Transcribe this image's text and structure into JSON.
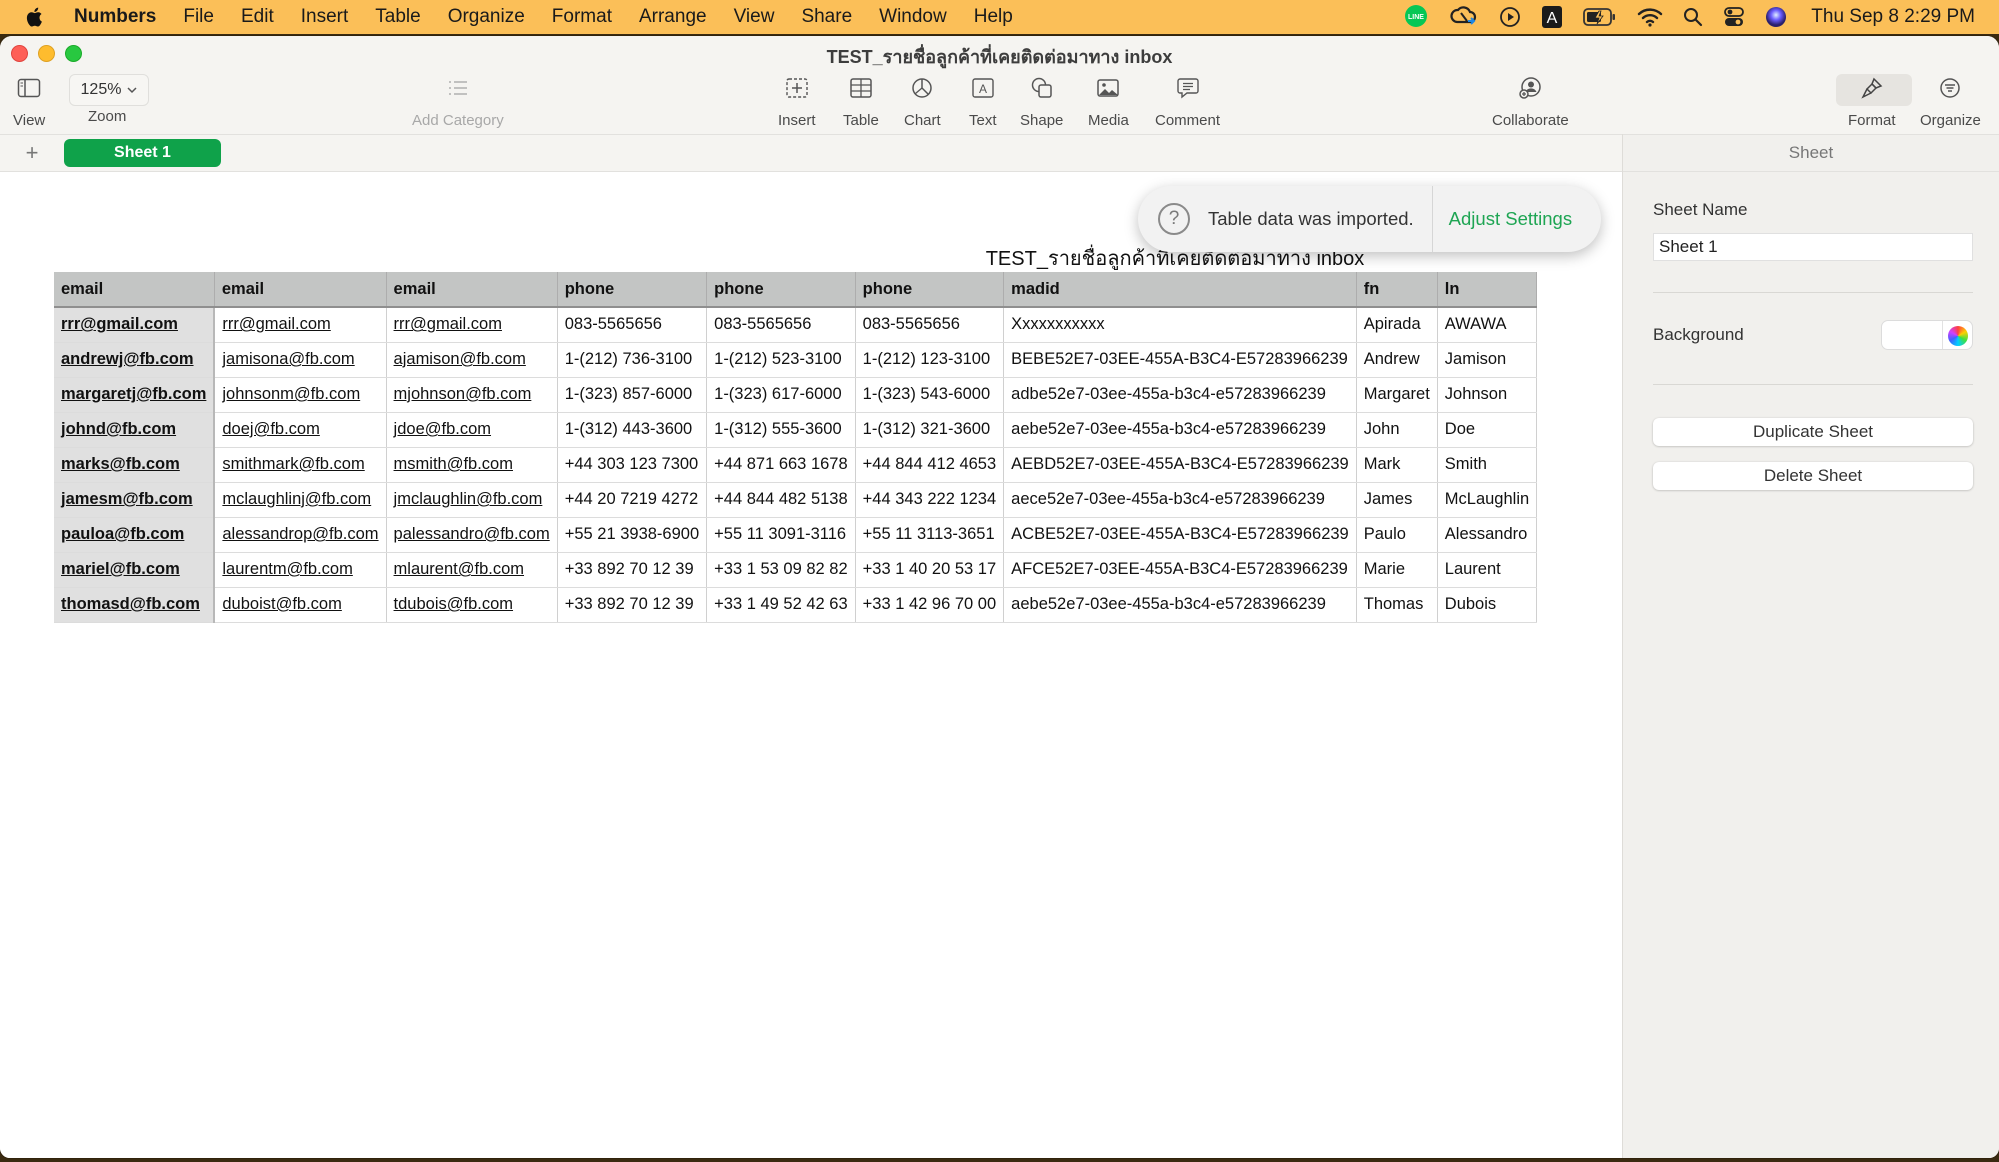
{
  "menubar": {
    "app_name": "Numbers",
    "items": [
      "File",
      "Edit",
      "Insert",
      "Table",
      "Organize",
      "Format",
      "Arrange",
      "View",
      "Share",
      "Window",
      "Help"
    ],
    "status_icons": [
      "line-icon",
      "creative-cloud-icon",
      "play-icon",
      "input-source-icon",
      "battery-charging-icon",
      "wifi-icon",
      "spotlight-search-icon",
      "control-center-icon",
      "siri-icon"
    ],
    "input_source_letter": "A",
    "line_text": "LINE",
    "clock": "Thu Sep 8  2:29 PM"
  },
  "window": {
    "title": "TEST_รายชื่อลูกค้าที่เคยติดต่อมาทาง inbox"
  },
  "toolbar": {
    "view": "View",
    "zoom_value": "125%",
    "zoom": "Zoom",
    "add_category": "Add Category",
    "insert": "Insert",
    "table": "Table",
    "chart": "Chart",
    "text": "Text",
    "shape": "Shape",
    "media": "Media",
    "comment": "Comment",
    "collaborate": "Collaborate",
    "format": "Format",
    "organize": "Organize"
  },
  "tabs": {
    "add_symbol": "+",
    "sheets": [
      "Sheet 1"
    ]
  },
  "canvas": {
    "table_title": "TEST_รายชื่อลูกค้าที่เคยติดต่อมาทาง inbox",
    "columns": [
      "email",
      "email",
      "email",
      "phone",
      "phone",
      "phone",
      "madid",
      "fn",
      "ln"
    ],
    "rows": [
      [
        "rrr@gmail.com",
        "rrr@gmail.com",
        "rrr@gmail.com",
        "083-5565656",
        "083-5565656",
        "083-5565656",
        "Xxxxxxxxxxx",
        "Apirada",
        "AWAWA"
      ],
      [
        "andrewj@fb.com",
        "jamisona@fb.com",
        "ajamison@fb.com",
        "1-(212) 736-3100",
        "1-(212) 523-3100",
        "1-(212) 123-3100",
        "BEBE52E7-03EE-455A-B3C4-E57283966239",
        "Andrew",
        "Jamison"
      ],
      [
        "margaretj@fb.com",
        "johnsonm@fb.com",
        "mjohnson@fb.com",
        "1-(323) 857-6000",
        "1-(323) 617-6000",
        "1-(323) 543-6000",
        "adbe52e7-03ee-455a-b3c4-e57283966239",
        "Margaret",
        "Johnson"
      ],
      [
        "johnd@fb.com",
        "doej@fb.com",
        "jdoe@fb.com",
        "1-(312) 443-3600",
        "1-(312) 555-3600",
        "1-(312) 321-3600",
        "aebe52e7-03ee-455a-b3c4-e57283966239",
        "John",
        "Doe"
      ],
      [
        "marks@fb.com",
        "smithmark@fb.com",
        "msmith@fb.com",
        "+44 303 123 7300",
        "+44 871 663 1678",
        "+44 844 412 4653",
        "AEBD52E7-03EE-455A-B3C4-E57283966239",
        "Mark",
        "Smith"
      ],
      [
        "jamesm@fb.com",
        "mclaughlinj@fb.com",
        "jmclaughlin@fb.com",
        "+44 20 7219 4272",
        "+44 844 482 5138",
        "+44 343 222 1234",
        "aece52e7-03ee-455a-b3c4-e57283966239",
        "James",
        "McLaughlin"
      ],
      [
        "pauloa@fb.com",
        "alessandrop@fb.com",
        "palessandro@fb.com",
        "+55 21 3938-6900",
        "+55 11 3091-3116",
        "+55 11 3113-3651",
        "ACBE52E7-03EE-455A-B3C4-E57283966239",
        "Paulo",
        "Alessandro"
      ],
      [
        "mariel@fb.com",
        "laurentm@fb.com",
        "mlaurent@fb.com",
        "+33 892 70 12 39",
        "+33 1 53 09 82 82",
        "+33 1 40 20 53 17",
        "AFCE52E7-03EE-455A-B3C4-E57283966239",
        "Marie",
        "Laurent"
      ],
      [
        "thomasd@fb.com",
        "duboist@fb.com",
        "tdubois@fb.com",
        "+33 892 70 12 39",
        "+33 1 49 52 42 63",
        "+33 1 42 96 70 00",
        "aebe52e7-03ee-455a-b3c4-e57283966239",
        "Thomas",
        "Dubois"
      ]
    ]
  },
  "toast": {
    "icon": "question-icon",
    "icon_glyph": "?",
    "message": "Table data was imported.",
    "action": "Adjust Settings",
    "action_color": "#1ea553"
  },
  "inspector": {
    "tab": "Sheet",
    "sheet_name_label": "Sheet Name",
    "sheet_name_value": "Sheet 1",
    "background_label": "Background",
    "background_color": "#ffffff",
    "duplicate": "Duplicate Sheet",
    "delete": "Delete Sheet"
  },
  "colors": {
    "menubar": "#fbbf58",
    "accent_green": "#0fa24a",
    "header_row": "#c3c5c4",
    "header_col": "#e0e0e0"
  }
}
